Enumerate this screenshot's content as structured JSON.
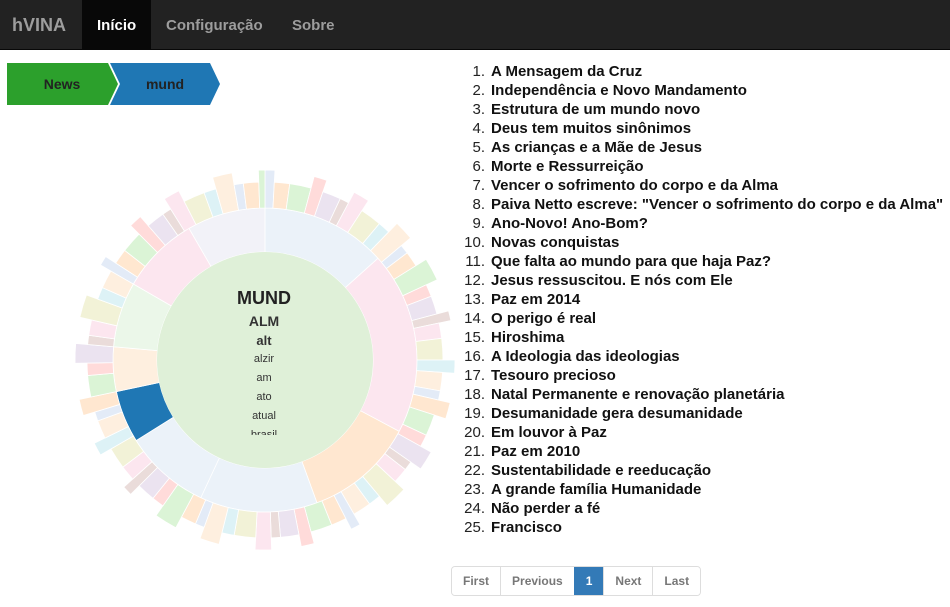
{
  "navbar": {
    "brand": "hVINA",
    "items": [
      {
        "label": "Início",
        "active": true
      },
      {
        "label": "Configuração",
        "active": false
      },
      {
        "label": "Sobre",
        "active": false
      }
    ]
  },
  "breadcrumb": {
    "items": [
      {
        "label": "News",
        "color": "#2ca02c"
      },
      {
        "label": "mund",
        "color": "#1f77b4"
      }
    ]
  },
  "sunburst": {
    "center_title": "MUND",
    "center_words": [
      "ALM",
      "alt",
      "alzir",
      "am",
      "ato",
      "atual",
      "brasil"
    ],
    "selected_color": "#1f77b4"
  },
  "documents": [
    "A Mensagem da Cruz",
    "Independência e Novo Mandamento",
    "Estrutura de um mundo novo",
    "Deus tem muitos sinônimos",
    "As crianças e a Mãe de Jesus",
    "Morte e Ressurreição",
    "Vencer o sofrimento do corpo e da Alma",
    "Paiva Netto escreve: \"Vencer o sofrimento do corpo e da Alma\"",
    "Ano-Novo! Ano-Bom?",
    "Novas conquistas",
    "Que falta ao mundo para que haja Paz?",
    "Jesus ressuscitou. E nós com Ele",
    "Paz em 2014",
    "O perigo é real",
    "Hiroshima",
    "A Ideologia das ideologias",
    "Tesouro precioso",
    "Natal Permanente e renovação planetária",
    "Desumanidade gera desumanidade",
    "Em louvor à Paz",
    "Paz em 2010",
    "Sustentabilidade e reeducação",
    "A grande família Humanidade",
    "Não perder a fé",
    "Francisco"
  ],
  "pagination": {
    "first": "First",
    "previous": "Previous",
    "current": "1",
    "next": "Next",
    "last": "Last"
  }
}
